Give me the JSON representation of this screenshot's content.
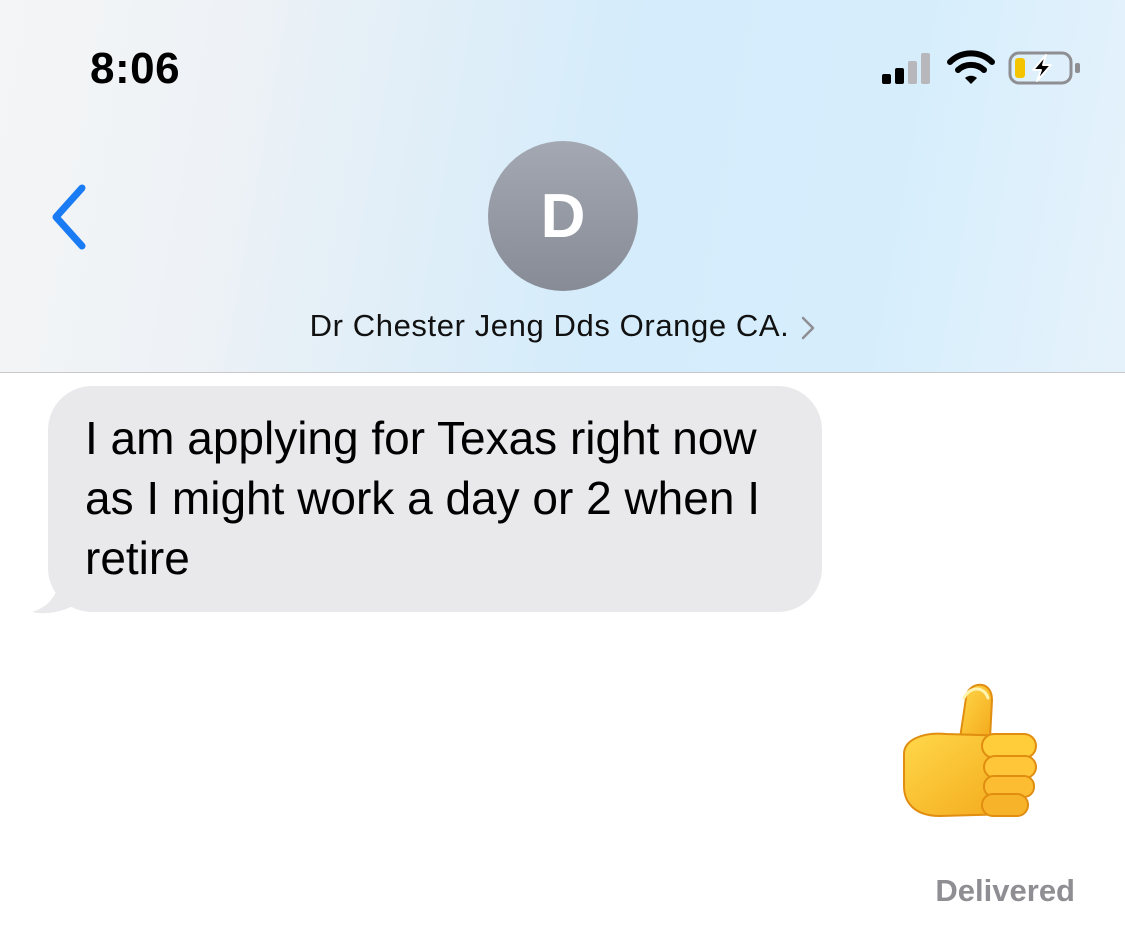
{
  "status_bar": {
    "time": "8:06",
    "signal_icon": "cellular-signal-icon",
    "wifi_icon": "wifi-icon",
    "battery_icon": "battery-charging-icon",
    "battery_color": "#f5c400"
  },
  "header": {
    "back_icon": "chevron-left-icon",
    "avatar_initial": "D",
    "contact_name": "Dr Chester Jeng Dds Orange CA.",
    "detail_icon": "chevron-right-icon"
  },
  "messages": [
    {
      "direction": "incoming",
      "text": "I am applying for Texas right now as I might work a day or 2 when I retire"
    },
    {
      "direction": "outgoing",
      "emoji": "thumbs-up-icon",
      "status": "Delivered"
    }
  ],
  "colors": {
    "accent": "#1a7cf5",
    "incoming_bubble": "#e9e9eb",
    "status_text": "#8e8e93"
  }
}
